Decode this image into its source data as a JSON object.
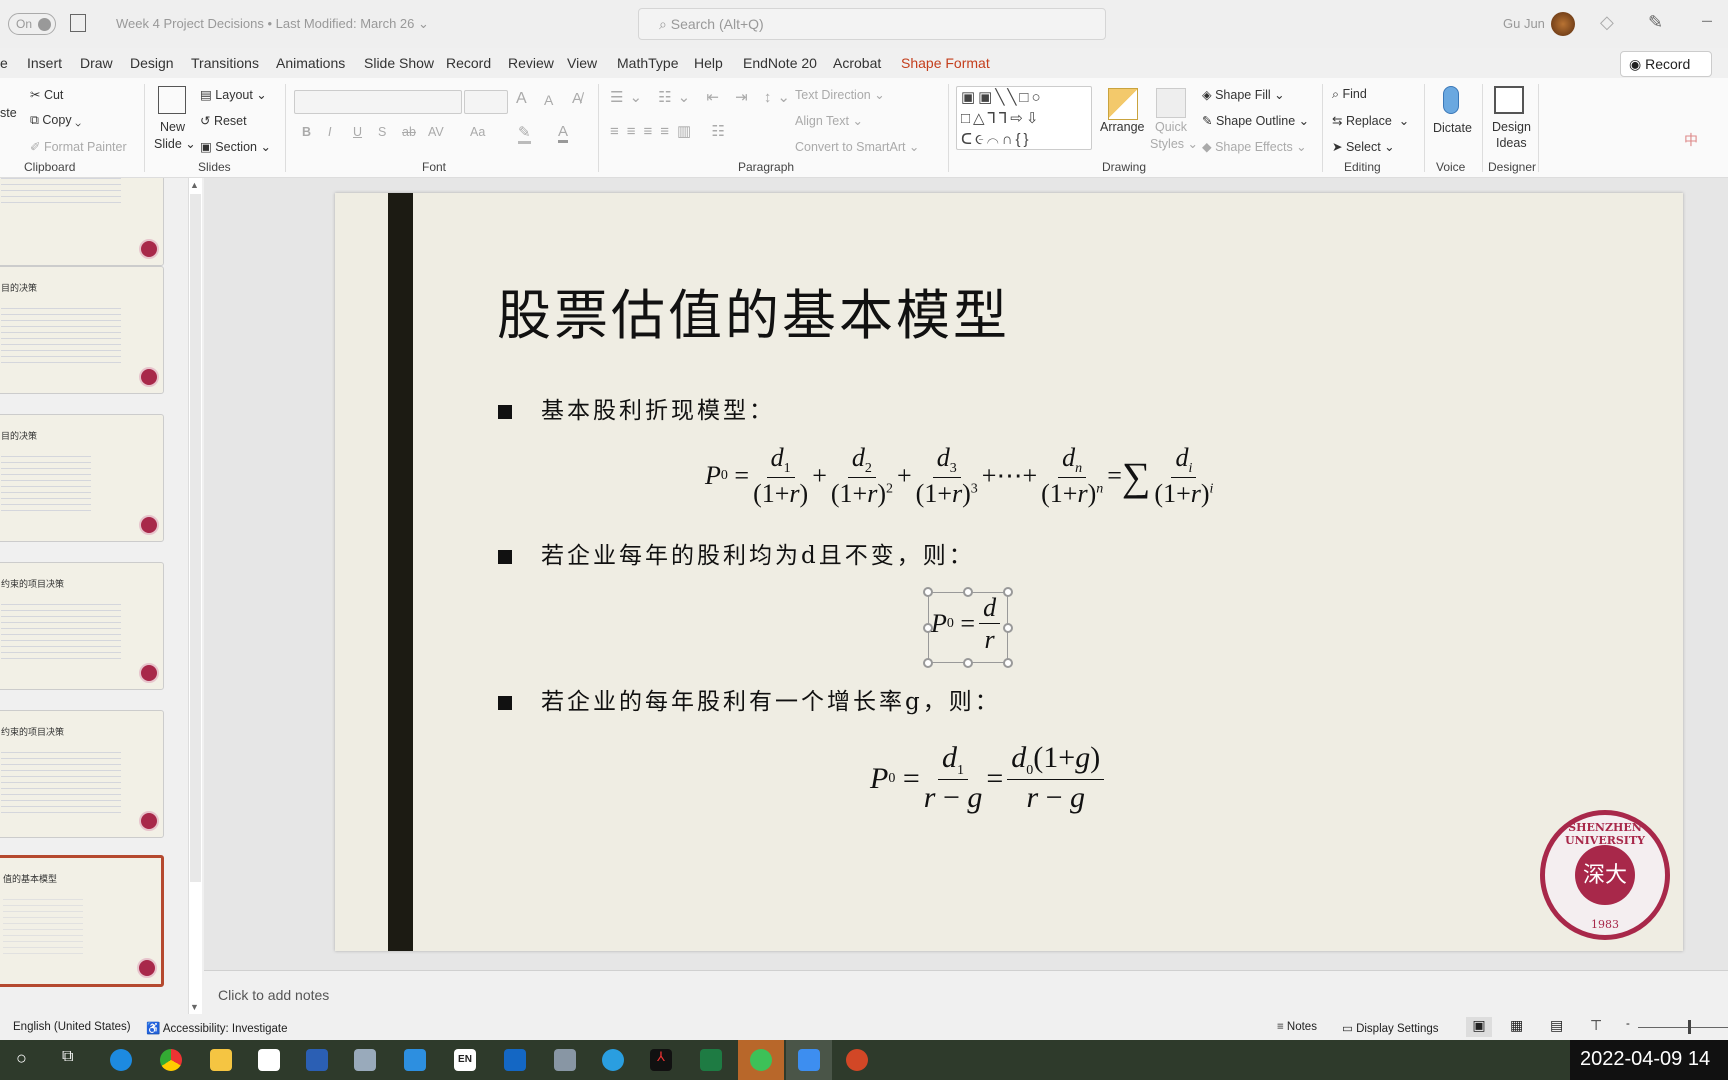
{
  "titlebar": {
    "autosave": "On",
    "doc_title": "Week 4 Project Decisions • Last Modified: March 26 ⌄",
    "search_placeholder": "Search (Alt+Q)",
    "user": "Gu Jun"
  },
  "menu": {
    "tabs": [
      "e",
      "Insert",
      "Draw",
      "Design",
      "Transitions",
      "Animations",
      "Slide Show",
      "Record",
      "Review",
      "View",
      "MathType",
      "Help",
      "EndNote 20",
      "Acrobat",
      "Shape Format"
    ],
    "active": "Shape Format",
    "record": "Record"
  },
  "ribbon": {
    "clipboard": {
      "paste": "ste",
      "cut": "Cut",
      "copy": "Copy",
      "format_painter": "Format Painter",
      "label": "Clipboard"
    },
    "slides": {
      "new_slide": "New",
      "new_slide2": "Slide ⌄",
      "layout": "Layout ⌄",
      "reset": "Reset",
      "section": "Section ⌄",
      "label": "Slides"
    },
    "font": {
      "label": "Font",
      "bold": "B",
      "italic": "I",
      "underline": "U",
      "shadow": "S",
      "strike": "ab",
      "spacing": "AV",
      "case": "Aa",
      "grow": "A",
      "shrink": "A"
    },
    "paragraph": {
      "text_direction": "Text Direction ⌄",
      "align_text": "Align Text ⌄",
      "smartart": "Convert to SmartArt ⌄",
      "label": "Paragraph"
    },
    "drawing": {
      "arrange": "Arrange",
      "quick_styles": "Quick",
      "quick_styles2": "Styles ⌄",
      "shape_fill": "Shape Fill ⌄",
      "shape_outline": "Shape Outline ⌄",
      "shape_effects": "Shape Effects ⌄",
      "label": "Drawing"
    },
    "editing": {
      "find": "Find",
      "replace": "Replace",
      "select": "Select ⌄",
      "label": "Editing"
    },
    "voice": {
      "dictate": "Dictate",
      "label": "Voice"
    },
    "designer": {
      "design_ideas": "Design",
      "design_ideas2": "Ideas",
      "label": "Designer"
    }
  },
  "thumbnails": [
    {
      "title": ""
    },
    {
      "title": "目的决策"
    },
    {
      "title": "目的决策"
    },
    {
      "title": "约束的项目决策"
    },
    {
      "title": "约束的项目决策"
    },
    {
      "title": "值的基本模型",
      "selected": true
    }
  ],
  "slide": {
    "title": "股票估值的基本模型",
    "bullets": [
      "基本股利折现模型：",
      "若企业每年的股利均为d且不变，则：",
      "若企业的每年股利有一个增长率g，则："
    ],
    "seal": {
      "text": "SHENZHEN UNIVERSITY",
      "year": "1983",
      "center": "深大"
    }
  },
  "notes": {
    "placeholder": "Click to add notes"
  },
  "status": {
    "language": "English (United States)",
    "accessibility": "Accessibility: Investigate",
    "notes": "Notes",
    "display_settings": "Display Settings"
  },
  "taskbar": {
    "clock": "2022-04-09 14"
  },
  "colors": {
    "accent": "#c43e1c",
    "selected_thumb": "#b5492f",
    "seal": "#a8284a",
    "taskbar": "#2e3a2b"
  }
}
